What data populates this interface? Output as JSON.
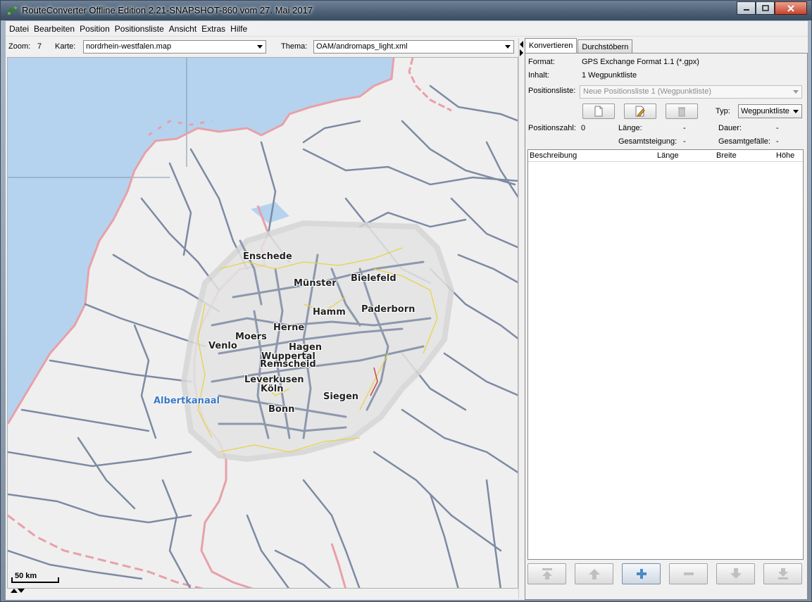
{
  "window": {
    "title": "RouteConverter Offline Edition 2.21-SNAPSHOT-860 vom 27. Mai 2017"
  },
  "menu": {
    "items": [
      "Datei",
      "Bearbeiten",
      "Position",
      "Positionsliste",
      "Ansicht",
      "Extras",
      "Hilfe"
    ]
  },
  "map_toolbar": {
    "zoom_label": "Zoom:",
    "zoom_value": "7",
    "karte_label": "Karte:",
    "karte_value": "nordrhein-westfalen.map",
    "thema_label": "Thema:",
    "thema_value": "OAM/andromaps_light.xml"
  },
  "map": {
    "cities": [
      "Enschede",
      "Münster",
      "Bielefeld",
      "Hamm",
      "Paderborn",
      "Herne",
      "Moers",
      "Venlo",
      "Hagen",
      "Wuppertal",
      "Remscheid",
      "Leverkusen",
      "Köln",
      "Siegen",
      "Bonn"
    ],
    "water_label": "Albertkanaal",
    "scale_label": "50 km",
    "colors": {
      "water": "#b5d3ef",
      "land": "#efefef",
      "road": "#7d8aa3",
      "border": "#e8a0a8",
      "coverage": "#dadada"
    }
  },
  "tabs": {
    "konvertieren": "Konvertieren",
    "durchstobern": "Durchstöbern"
  },
  "convert": {
    "format_label": "Format:",
    "format_value": "GPS Exchange Format 1.1 (*.gpx)",
    "inhalt_label": "Inhalt:",
    "inhalt_value": "1 Wegpunktliste",
    "positionsliste_label": "Positionsliste:",
    "positionsliste_value": "Neue Positionsliste 1 (Wegpunktliste)",
    "typ_label": "Typ:",
    "typ_value": "Wegpunktliste",
    "positionszahl_label": "Positionszahl:",
    "positionszahl_value": "0",
    "laenge_label": "Länge:",
    "laenge_value": "-",
    "dauer_label": "Dauer:",
    "dauer_value": "-",
    "gesamtsteigung_label": "Gesamtsteigung:",
    "gesamtsteigung_value": "-",
    "gesamtgefaelle_label": "Gesamtgefälle:",
    "gesamtgefaelle_value": "-"
  },
  "table": {
    "columns": [
      "Beschreibung",
      "Länge",
      "Breite",
      "Höhe"
    ]
  }
}
